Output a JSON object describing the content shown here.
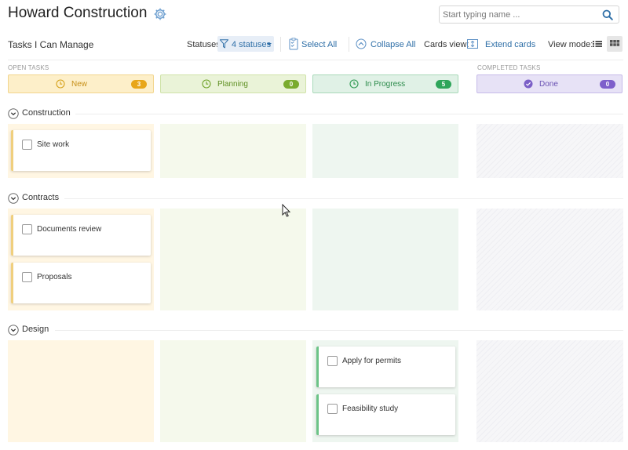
{
  "header": {
    "title": "Howard Construction",
    "search_placeholder": "Start typing name ..."
  },
  "toolbar": {
    "view_title": "Tasks I Can Manage",
    "statuses_label": "Statuses:",
    "statuses_value": "4 statuses",
    "select_all": "Select All",
    "collapse_all": "Collapse All",
    "cards_view_label": "Cards view:",
    "extend_cards": "Extend cards",
    "view_mode_label": "View mode:"
  },
  "sections": {
    "open": "OPEN TASKS",
    "completed": "COMPLETED TASKS"
  },
  "statuses": [
    {
      "label": "New",
      "count": "3",
      "color": "#d6a21b",
      "badge": "#e8a619"
    },
    {
      "label": "Planning",
      "count": "0",
      "color": "#6fa32a",
      "badge": "#7aab2e"
    },
    {
      "label": "In Progress",
      "count": "5",
      "color": "#2f9a52",
      "badge": "#2ea55a"
    },
    {
      "label": "Done",
      "count": "0",
      "color": "#7b5fc7",
      "badge": "#7e5fcb"
    }
  ],
  "groups": [
    {
      "name": "Construction",
      "cards": {
        "new": [
          "Site work"
        ],
        "progress": []
      }
    },
    {
      "name": "Contracts",
      "cards": {
        "new": [
          "Documents review",
          "Proposals"
        ],
        "progress": []
      }
    },
    {
      "name": "Design",
      "cards": {
        "new": [],
        "progress": [
          "Apply for permits",
          "Feasibility study"
        ]
      }
    }
  ]
}
